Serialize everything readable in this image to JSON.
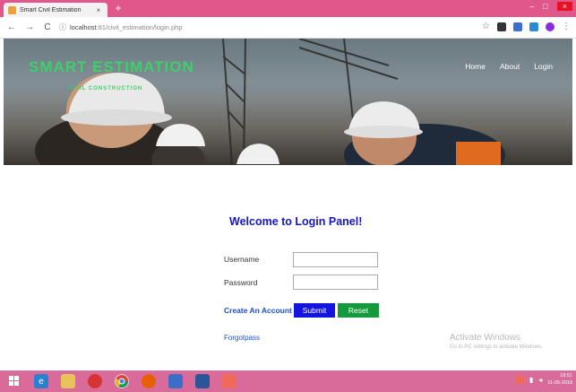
{
  "browser": {
    "tab_title": "Smart Civil Estimation",
    "tab_close": "×",
    "new_tab": "+",
    "url_host": "localhost",
    "url_rest": ":81/civil_estimation/login.php",
    "back": "←",
    "forward": "→",
    "reload": "C",
    "info": "ⓘ",
    "star": "☆",
    "menu": "⋮",
    "min": "–",
    "max": "□",
    "close": "×"
  },
  "site": {
    "brand": "SMART ESTIMATION",
    "tagline": "CIVIL CONSTRUCTION",
    "nav": [
      "Home",
      "About",
      "Login"
    ]
  },
  "login": {
    "title": "Welcome to Login Panel!",
    "username_label": "Username",
    "password_label": "Password",
    "username_value": "",
    "password_value": "",
    "create_account": "Create An Account",
    "submit": "Submit",
    "reset": "Reset",
    "forgot": "Forgotpass"
  },
  "watermark": {
    "title": "Activate Windows",
    "subtitle": "Go to PC settings to activate Windows."
  },
  "taskbar": {
    "time": "19:51",
    "date": "11-05-2019"
  },
  "colors": {
    "titlebar": "#e1578b",
    "brand": "#3ecf6a",
    "panel_title": "#1616c8",
    "submit": "#1414e0",
    "reset": "#149a3c",
    "taskbar": "#d96b9a"
  }
}
